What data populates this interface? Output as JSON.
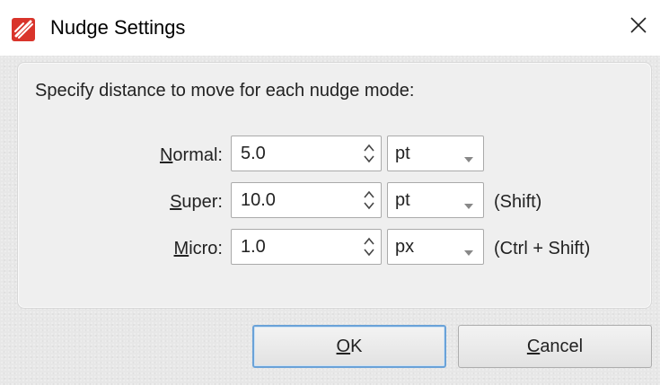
{
  "window": {
    "title": "Nudge Settings",
    "close_symbol": "✕",
    "icon": "app-logo-icon"
  },
  "main": {
    "instruction": "Specify distance to move for each nudge mode:",
    "rows": [
      {
        "mnemonic": "N",
        "label_rest": "ormal:",
        "value": "5.0",
        "unit": "pt",
        "hint": ""
      },
      {
        "mnemonic": "S",
        "label_rest": "uper:",
        "value": "10.0",
        "unit": "pt",
        "hint": "(Shift)"
      },
      {
        "mnemonic": "M",
        "label_rest": "icro:",
        "value": "1.0",
        "unit": "px",
        "hint": "(Ctrl + Shift)"
      }
    ]
  },
  "buttons": {
    "ok": {
      "mnemonic": "O",
      "rest": "K"
    },
    "cancel": {
      "mnemonic": "C",
      "rest": "ancel"
    }
  },
  "colors": {
    "accent_border": "#6aa2d8",
    "logo_red": "#d9342b"
  }
}
